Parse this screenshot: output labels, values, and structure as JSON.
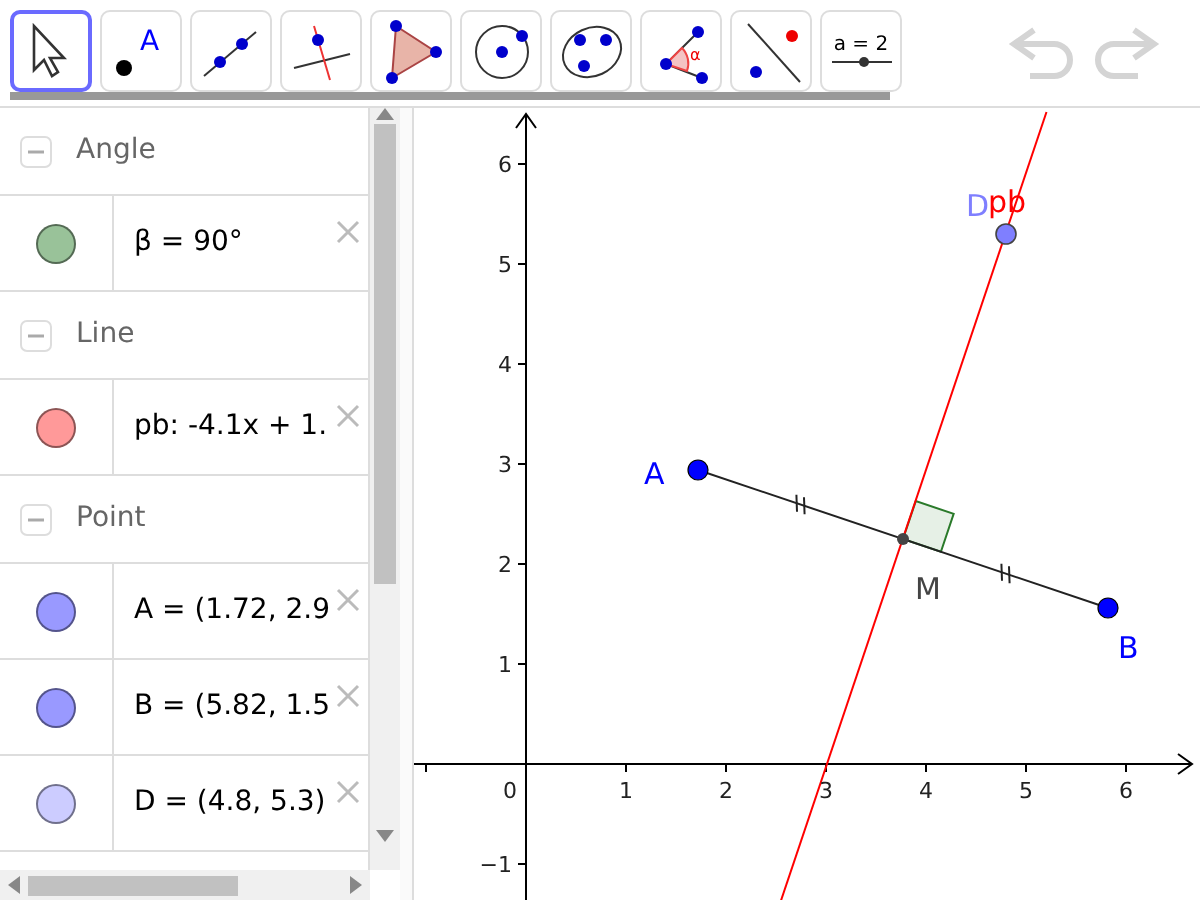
{
  "toolbar": {
    "tools": [
      {
        "kind": "move",
        "selected": true
      },
      {
        "kind": "point",
        "selected": false,
        "icon_text": "A"
      },
      {
        "kind": "line",
        "selected": false
      },
      {
        "kind": "perpendicular",
        "selected": false
      },
      {
        "kind": "polygon",
        "selected": false
      },
      {
        "kind": "circle",
        "selected": false
      },
      {
        "kind": "conic",
        "selected": false
      },
      {
        "kind": "angle",
        "selected": false,
        "icon_text": "α"
      },
      {
        "kind": "reflect",
        "selected": false
      },
      {
        "kind": "slider",
        "selected": false,
        "icon_text": "a = 2"
      }
    ],
    "undo": {
      "disabled": true
    },
    "redo": {
      "disabled": true
    }
  },
  "algebra": {
    "categories": [
      {
        "label": "Angle",
        "expanded": true,
        "items": [
          {
            "text": "β = 90°",
            "color": "#99c299"
          }
        ]
      },
      {
        "label": "Line",
        "expanded": true,
        "items": [
          {
            "text": "pb: -4.1x + 1.",
            "color": "#ff9999"
          }
        ]
      },
      {
        "label": "Point",
        "expanded": true,
        "items": [
          {
            "text": "A = (1.72, 2.9",
            "color": "#9999ff"
          },
          {
            "text": "B = (5.82, 1.5",
            "color": "#9999ff"
          },
          {
            "text": "D = (4.8, 5.3)",
            "color": "#ccccff"
          }
        ]
      }
    ]
  },
  "graphics": {
    "x_tick_labels": [
      "0",
      "1",
      "2",
      "3",
      "4",
      "5",
      "6"
    ],
    "y_tick_labels": [
      "6",
      "5",
      "4",
      "3",
      "2",
      "1",
      "−1"
    ],
    "labels": [
      {
        "text": "A",
        "color": "#0000ff"
      },
      {
        "text": "B",
        "color": "#0000ff"
      },
      {
        "text": "M",
        "color": "#444444"
      },
      {
        "text": "D",
        "color": "#7f7fff"
      },
      {
        "text": "pb",
        "color": "#ff0000"
      }
    ]
  }
}
